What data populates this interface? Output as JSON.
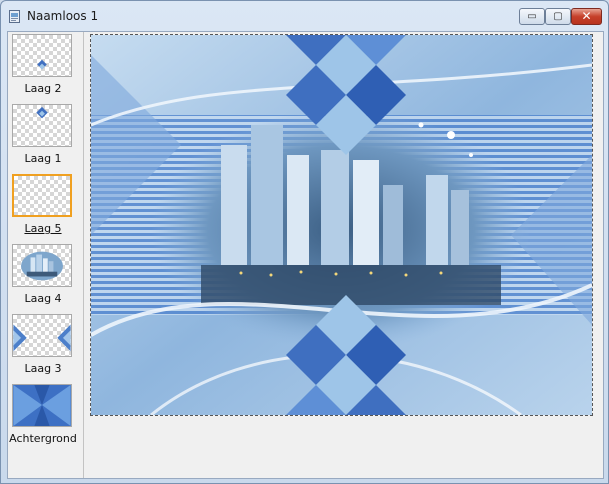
{
  "window": {
    "title": "Naamloos 1",
    "controls": {
      "minimize": "▭",
      "maximize": "▢",
      "close": "✕"
    }
  },
  "layers": [
    {
      "label": "Laag 2",
      "selected": false,
      "preview": "small-diamond-on-transparency"
    },
    {
      "label": "Laag 1",
      "selected": false,
      "preview": "small-diamond-top-on-transparency"
    },
    {
      "label": "Laag 5",
      "selected": true,
      "preview": "transparent"
    },
    {
      "label": "Laag 4",
      "selected": false,
      "preview": "city-skyline"
    },
    {
      "label": "Laag 3",
      "selected": false,
      "preview": "side-triangles"
    },
    {
      "label": "Achtergrond",
      "selected": false,
      "preview": "blue-background"
    }
  ],
  "colors": {
    "accent_selected": "#f0a020",
    "diamond_dark": "#3f6fc0",
    "diamond_light": "#9ec5e8",
    "sky": "#6f9fd6"
  }
}
